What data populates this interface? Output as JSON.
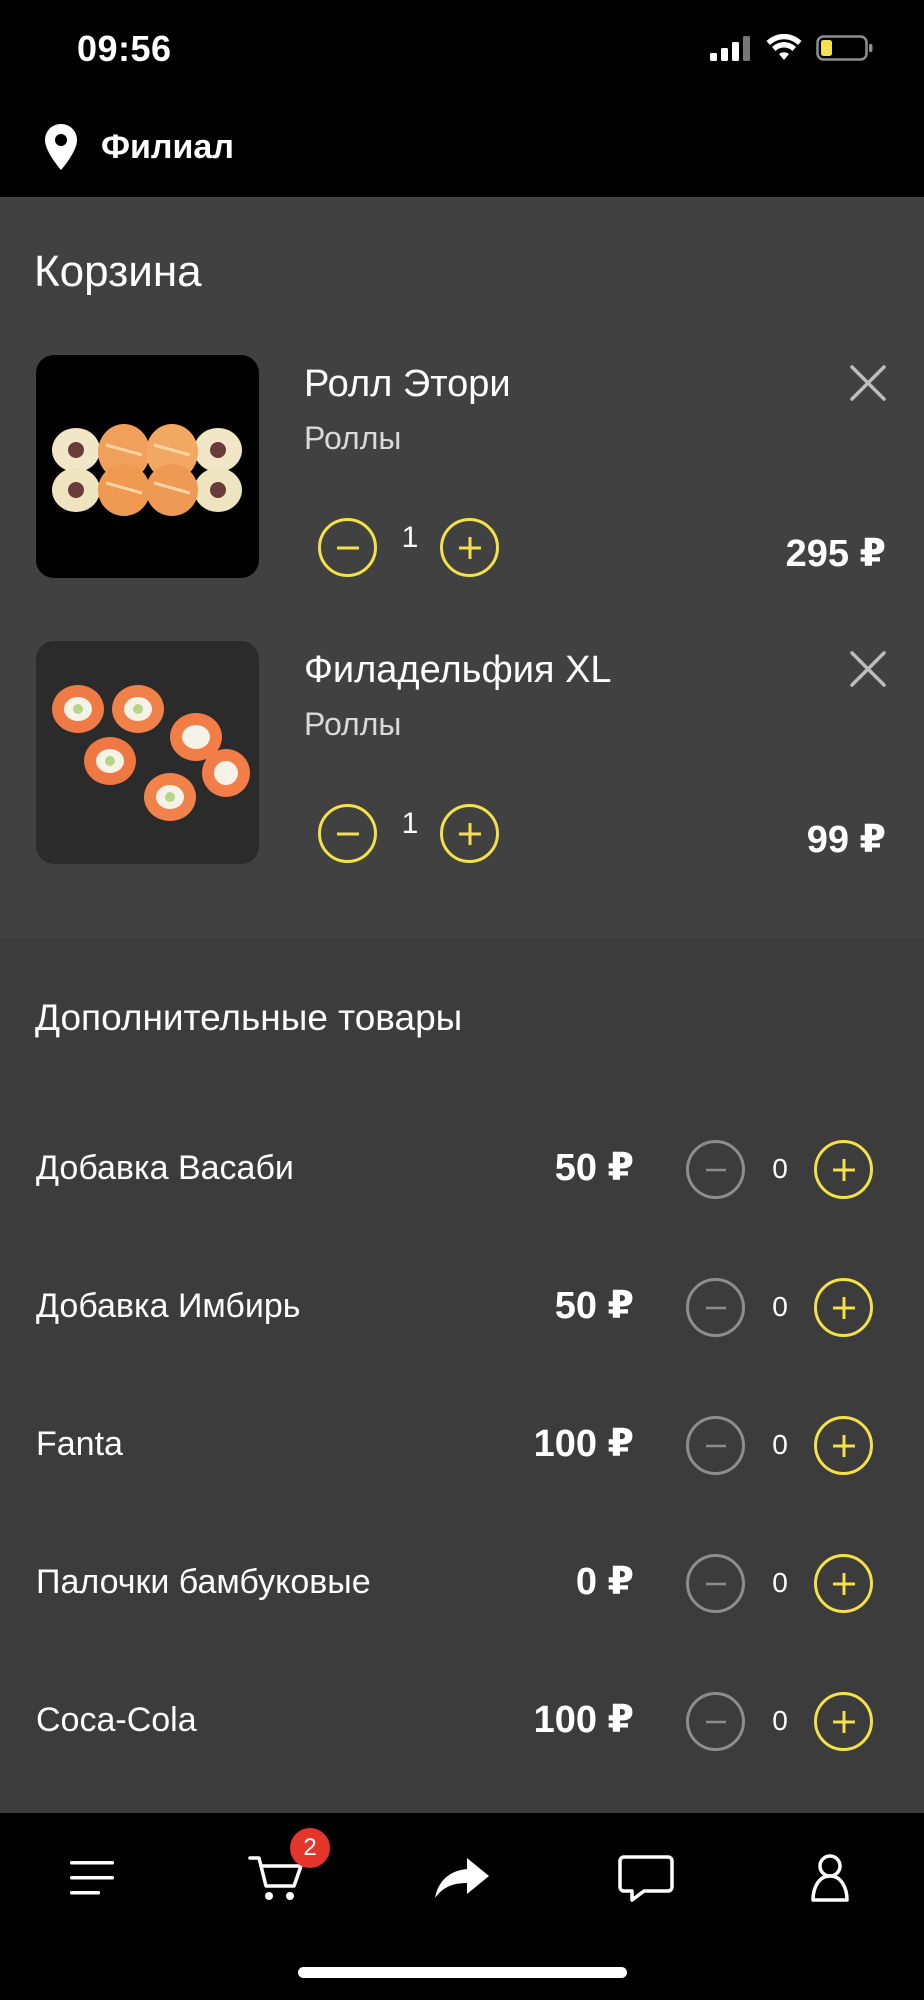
{
  "status_bar": {
    "time": "09:56"
  },
  "header": {
    "branch_label": "Филиал"
  },
  "cart": {
    "title": "Корзина",
    "items": [
      {
        "name": "Ролл Этори",
        "category": "Роллы",
        "quantity": "1",
        "price": "295 ₽"
      },
      {
        "name": "Филадельфия XL",
        "category": "Роллы",
        "quantity": "1",
        "price": "99 ₽"
      }
    ]
  },
  "extras": {
    "title": "Дополнительные товары",
    "items": [
      {
        "name": "Добавка Васаби",
        "price": "50 ₽",
        "count": "0"
      },
      {
        "name": "Добавка Имбирь",
        "price": "50 ₽",
        "count": "0"
      },
      {
        "name": "Fanta",
        "price": "100 ₽",
        "count": "0"
      },
      {
        "name": "Палочки бамбуковые",
        "price": "0 ₽",
        "count": "0"
      },
      {
        "name": "Coca-Cola",
        "price": "100 ₽",
        "count": "0"
      }
    ]
  },
  "bottom_nav": {
    "items": [
      "menu-icon",
      "cart-icon",
      "share-icon",
      "chat-icon",
      "profile-icon"
    ],
    "cart_badge": "2"
  },
  "colors": {
    "accent": "#f3e04a",
    "badge": "#e5352b",
    "background": "#3d3c3c"
  }
}
